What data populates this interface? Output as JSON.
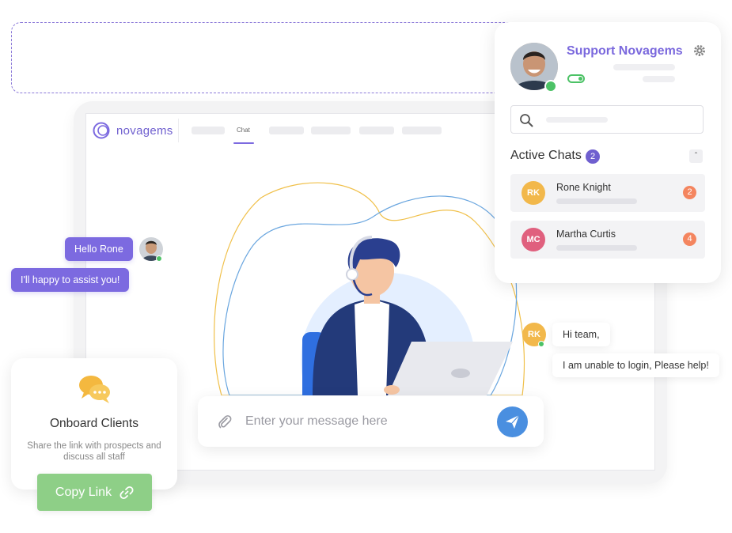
{
  "brand": {
    "name": "novagems",
    "accent": "#7c6ae0"
  },
  "nav": {
    "active_tab": "Chat"
  },
  "support_panel": {
    "title": "Support Novagems",
    "active_chats_label": "Active Chats",
    "active_chats_count": "2",
    "collapse_symbol": "ˆ",
    "chats": [
      {
        "initials": "RK",
        "name": "Rone Knight",
        "unread": "2",
        "color": "#f2b84b"
      },
      {
        "initials": "MC",
        "name": "Martha Curtis",
        "unread": "4",
        "color": "#e0607e"
      }
    ]
  },
  "agent_messages": {
    "hello": "Hello Rone",
    "assist": "I'll happy to assist you!"
  },
  "customer_messages": {
    "initials": "RK",
    "greeting": "Hi team,",
    "problem": "I am unable to login, Please help!"
  },
  "onboard": {
    "title": "Onboard Clients",
    "description": "Share the link with prospects and discuss all staff",
    "button_label": "Copy Link"
  },
  "composer": {
    "placeholder": "Enter your message here"
  },
  "icons": [
    "gear-icon",
    "search-icon",
    "paperclip-icon",
    "send-icon",
    "link-icon",
    "chat-bubbles-icon"
  ]
}
